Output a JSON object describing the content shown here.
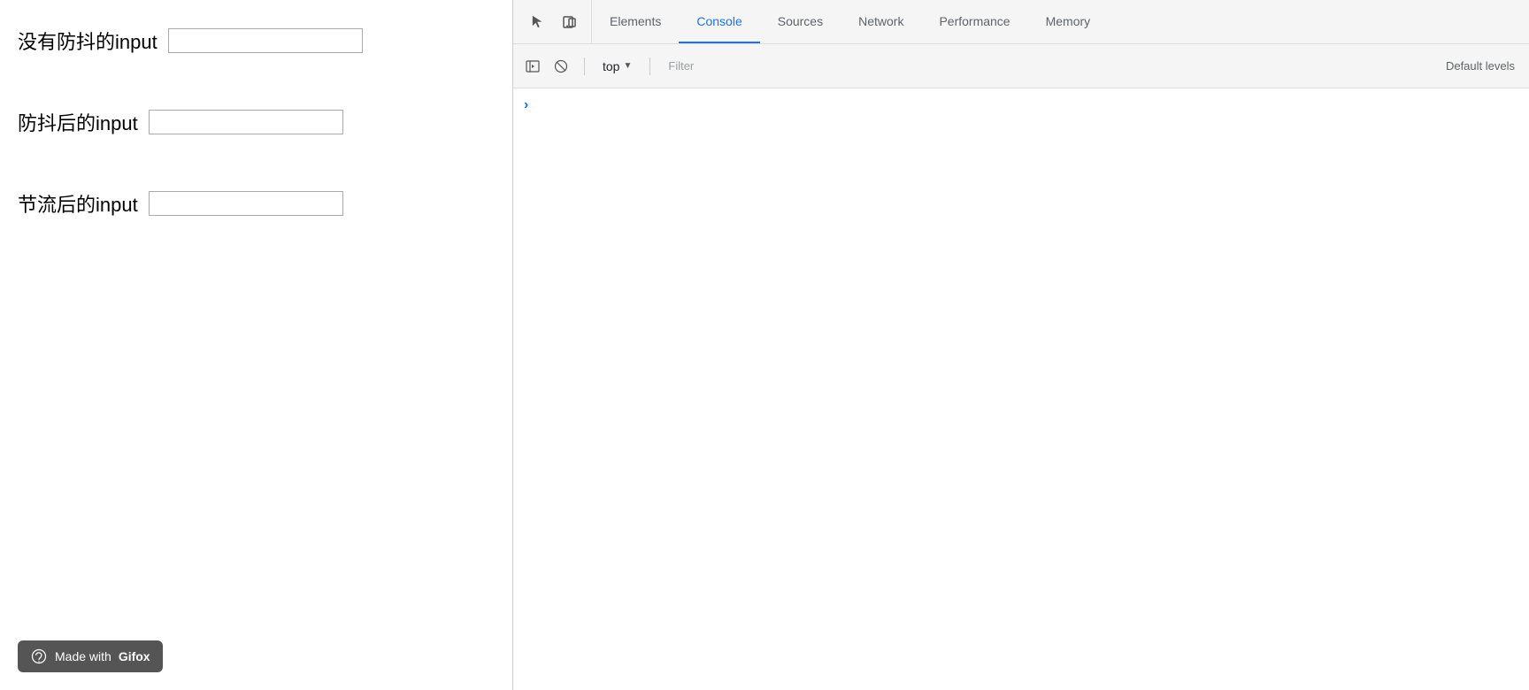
{
  "webpage": {
    "inputs": [
      {
        "label": "没有防抖的input",
        "id": "no-debounce",
        "placeholder": ""
      },
      {
        "label": "防抖后的input",
        "id": "debounce",
        "placeholder": ""
      },
      {
        "label": "节流后的input",
        "id": "throttle",
        "placeholder": ""
      }
    ],
    "badge": {
      "prefix": "Made with",
      "brand": "Gifox"
    }
  },
  "devtools": {
    "tabs": [
      {
        "id": "elements",
        "label": "Elements",
        "active": false
      },
      {
        "id": "console",
        "label": "Console",
        "active": true
      },
      {
        "id": "sources",
        "label": "Sources",
        "active": false
      },
      {
        "id": "network",
        "label": "Network",
        "active": false
      },
      {
        "id": "performance",
        "label": "Performance",
        "active": false
      },
      {
        "id": "memory",
        "label": "Memory",
        "active": false
      }
    ],
    "console": {
      "context": "top",
      "filter_placeholder": "Filter",
      "default_label": "Default levels"
    }
  }
}
